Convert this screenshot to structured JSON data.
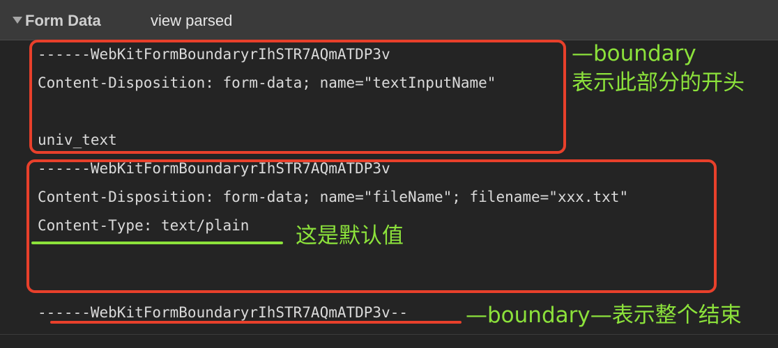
{
  "header": {
    "title": "Form Data",
    "toggle_label": "view parsed"
  },
  "body_lines": {
    "l1": "------WebKitFormBoundaryrIhSTR7AQmATDP3v",
    "l2": "Content-Disposition: form-data; name=\"textInputName\"",
    "l3": "univ_text",
    "l4": "------WebKitFormBoundaryrIhSTR7AQmATDP3v",
    "l5": "Content-Disposition: form-data; name=\"fileName\"; filename=\"xxx.txt\"",
    "l6": "Content-Type: text/plain",
    "l7": "------WebKitFormBoundaryrIhSTR7AQmATDP3v--"
  },
  "annotations": {
    "start_line1": "—boundary",
    "start_line2": "表示此部分的开头",
    "default_note": "这是默认值",
    "end_note": "—boundary—表示整个结束"
  },
  "colors": {
    "annotation_box": "#e8402b",
    "annotation_text": "#8ce23b",
    "background": "#242424",
    "header_background": "#3a3a3a"
  }
}
